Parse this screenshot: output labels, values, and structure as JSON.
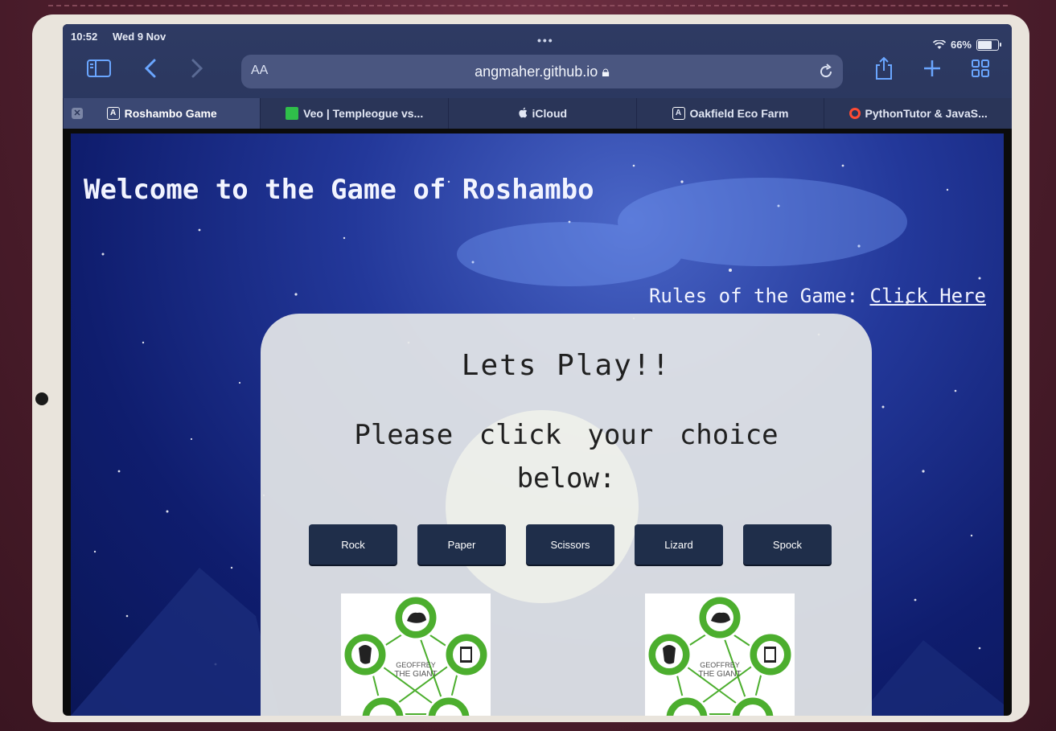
{
  "status": {
    "time": "10:52",
    "date": "Wed 9 Nov",
    "battery": "66%"
  },
  "toolbar": {
    "text_size_label": "AA",
    "url": "angmaher.github.io"
  },
  "tabs": [
    {
      "label": "Roshambo Game",
      "icon": "a-icon",
      "active": true
    },
    {
      "label": "Veo | Templeogue vs...",
      "icon": "green-square-icon",
      "active": false
    },
    {
      "label": "iCloud",
      "icon": "apple-icon",
      "active": false
    },
    {
      "label": "Oakfield Eco Farm",
      "icon": "a-icon",
      "active": false
    },
    {
      "label": "PythonTutor & JavaS...",
      "icon": "red-ring-icon",
      "active": false
    }
  ],
  "page": {
    "headline": "Welcome to the Game of Roshambo",
    "rules_prefix": "Rules of the Game: ",
    "rules_link": "Click Here",
    "lets_play": "Lets Play!!",
    "instruction": "Please click your choice below:",
    "choices": [
      "Rock",
      "Paper",
      "Scissors",
      "Lizard",
      "Spock"
    ],
    "diagram_text": "GEOFFREY THE GIANT"
  },
  "colors": {
    "accent": "#6aa6ff",
    "button": "#1f2e4a",
    "diagram_green": "#4cae2e"
  }
}
